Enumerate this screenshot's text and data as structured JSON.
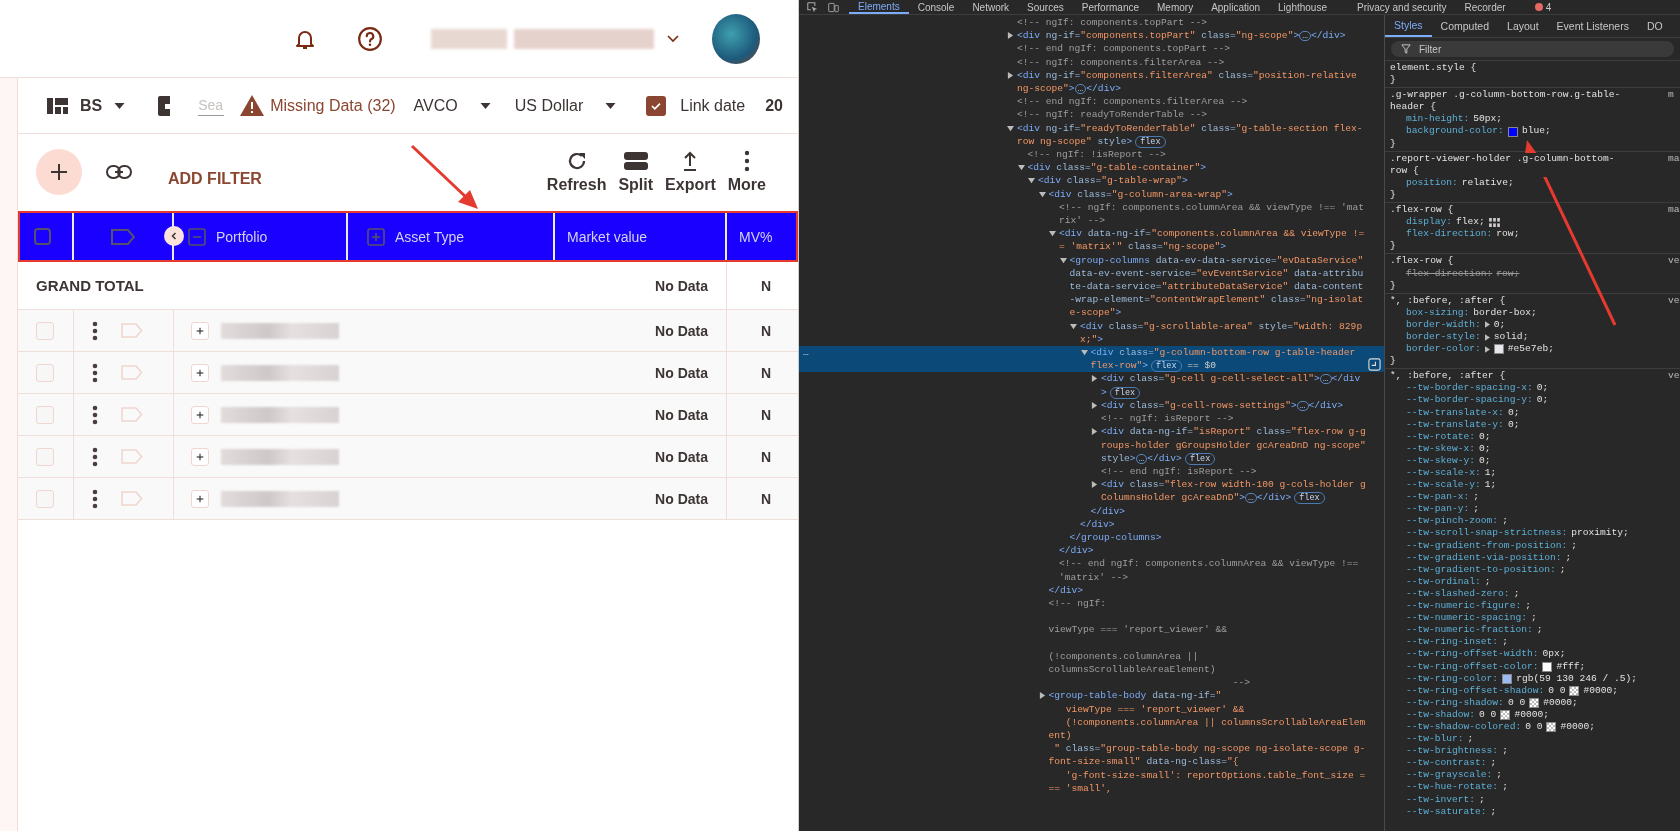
{
  "app": {
    "toolbar": {
      "layout": {
        "label": "BS"
      },
      "search": {
        "placeholder": "Sea"
      },
      "warning": {
        "label": "Missing Data (32)"
      },
      "cost_method": {
        "label": "AVCO"
      },
      "currency": {
        "label": "US Dollar"
      },
      "link_date": {
        "label": "Link date",
        "checked": true
      },
      "date": {
        "label": "20"
      }
    },
    "actions": {
      "add_filter": "ADD FILTER",
      "buttons": [
        {
          "label": "Refresh",
          "kind": "refresh"
        },
        {
          "label": "Split",
          "kind": "split"
        },
        {
          "label": "Export",
          "kind": "export"
        },
        {
          "label": "More",
          "kind": "more"
        }
      ]
    },
    "table": {
      "select_all_checked": false,
      "columns": [
        {
          "label": "Portfolio",
          "expanded": true
        },
        {
          "label": "Asset Type",
          "expanded": false
        },
        {
          "label": "Market value"
        },
        {
          "label": "MV%"
        }
      ],
      "grand_total": {
        "label": "GRAND TOTAL",
        "values": [
          "No Data",
          "N"
        ]
      },
      "rows": [
        {
          "checked": false,
          "expanded": false,
          "values": [
            "No Data",
            "N"
          ]
        },
        {
          "checked": false,
          "expanded": false,
          "values": [
            "No Data",
            "N"
          ]
        },
        {
          "checked": false,
          "expanded": false,
          "values": [
            "No Data",
            "N"
          ]
        },
        {
          "checked": false,
          "expanded": false,
          "values": [
            "No Data",
            "N"
          ]
        },
        {
          "checked": false,
          "expanded": false,
          "values": [
            "No Data",
            "N"
          ]
        }
      ]
    }
  },
  "devtools": {
    "tabs": [
      {
        "label": "Elements",
        "selected": true
      },
      {
        "label": "Console",
        "selected": false
      },
      {
        "label": "Network",
        "selected": false
      },
      {
        "label": "Sources",
        "selected": false
      },
      {
        "label": "Performance",
        "selected": false
      },
      {
        "label": "Memory",
        "selected": false
      },
      {
        "label": "Application",
        "selected": false
      },
      {
        "label": "Lighthouse",
        "selected": false
      },
      {
        "label": "Privacy and security",
        "selected": false
      },
      {
        "label": "Recorder",
        "selected": false
      }
    ],
    "error_count": "4",
    "elements": {
      "gutter_dots": "…",
      "nodes": [
        {
          "selected": false,
          "parts": [
            {
              "kind": "comment",
              "text": "<!-- ngIf: components.topPart -->"
            }
          ]
        },
        {
          "selected": false,
          "expanded": false,
          "parts": [
            {
              "kind": "tag",
              "text": "<div"
            },
            {
              "kind": "attr",
              "text": " ng-if="
            },
            {
              "kind": "value",
              "text": "\"components.topPart\""
            },
            {
              "kind": "attr",
              "text": " class="
            },
            {
              "kind": "value",
              "text": "\"ng-scope\""
            },
            {
              "kind": "tag",
              "text": ">"
            },
            {
              "kind": "ellipsis",
              "text": "…"
            },
            {
              "kind": "tag",
              "text": "</div>"
            }
          ]
        },
        {
          "selected": false,
          "parts": [
            {
              "kind": "comment",
              "text": "<!-- end ngIf: components.topPart -->"
            }
          ]
        },
        {
          "selected": false,
          "parts": [
            {
              "kind": "comment",
              "text": "<!-- ngIf: components.filterArea -->"
            }
          ]
        },
        {
          "selected": false,
          "expanded": false,
          "parts": [
            {
              "kind": "tag",
              "text": "<div"
            },
            {
              "kind": "attr",
              "text": " ng-if="
            },
            {
              "kind": "value",
              "text": "\"components.filterArea\""
            },
            {
              "kind": "attr",
              "text": " class="
            },
            {
              "kind": "value",
              "text": "\"position-relative ng-scope\""
            },
            {
              "kind": "tag",
              "text": ">"
            },
            {
              "kind": "ellipsis",
              "text": "…"
            },
            {
              "kind": "tag",
              "text": "</div>"
            }
          ]
        },
        {
          "selected": false,
          "parts": [
            {
              "kind": "comment",
              "text": "<!-- end ngIf: components.filterArea -->"
            }
          ]
        },
        {
          "selected": false,
          "parts": [
            {
              "kind": "comment",
              "text": "<!-- ngIf: readyToRenderTable -->"
            }
          ]
        },
        {
          "selected": false,
          "expanded": true,
          "parts": [
            {
              "kind": "tag",
              "text": "<div"
            },
            {
              "kind": "attr",
              "text": " ng-if="
            },
            {
              "kind": "value",
              "text": "\"readyToRenderTable\""
            },
            {
              "kind": "attr",
              "text": " class="
            },
            {
              "kind": "value",
              "text": "\"g-table-section flex-row ng-scope\""
            },
            {
              "kind": "attr",
              "text": " style"
            },
            {
              "kind": "tag",
              "text": ">"
            },
            {
              "kind": "badge",
              "text": "flex"
            }
          ],
          "children": [
            {
              "selected": false,
              "parts": [
                {
                  "kind": "comment",
                  "text": "<!-- ngIf: !isReport -->"
                }
              ]
            },
            {
              "selected": false,
              "expanded": true,
              "parts": [
                {
                  "kind": "tag",
                  "text": "<div"
                },
                {
                  "kind": "attr",
                  "text": " class="
                },
                {
                  "kind": "value",
                  "text": "\"g-table-container\""
                },
                {
                  "kind": "tag",
                  "text": ">"
                }
              ],
              "children": [
                {
                  "selected": false,
                  "expanded": true,
                  "parts": [
                    {
                      "kind": "tag",
                      "text": "<div"
                    },
                    {
                      "kind": "attr",
                      "text": " class="
                    },
                    {
                      "kind": "value",
                      "text": "\"g-table-wrap\""
                    },
                    {
                      "kind": "tag",
                      "text": ">"
                    }
                  ],
                  "children": [
                    {
                      "selected": false,
                      "expanded": true,
                      "parts": [
                        {
                          "kind": "tag",
                          "text": "<div"
                        },
                        {
                          "kind": "attr",
                          "text": " class="
                        },
                        {
                          "kind": "value",
                          "text": "\"g-column-area-wrap\""
                        },
                        {
                          "kind": "tag",
                          "text": ">"
                        }
                      ],
                      "close": [
                        {
                          "kind": "tag",
                          "text": "</div>"
                        }
                      ],
                      "children": [
                        {
                          "selected": false,
                          "parts": [
                            {
                              "kind": "comment",
                              "text": "<!-- ngIf: components.columnArea && viewType !== 'matrix' -->"
                            }
                          ]
                        },
                        {
                          "selected": false,
                          "expanded": true,
                          "parts": [
                            {
                              "kind": "tag",
                              "text": "<div"
                            },
                            {
                              "kind": "attr",
                              "text": " data-ng-if="
                            },
                            {
                              "kind": "value",
                              "text": "\"components.columnArea && viewType !== 'matrix'\""
                            },
                            {
                              "kind": "attr",
                              "text": " class="
                            },
                            {
                              "kind": "value",
                              "text": "\"ng-scope\""
                            },
                            {
                              "kind": "tag",
                              "text": ">"
                            }
                          ],
                          "close": [
                            {
                              "kind": "tag",
                              "text": "</div>"
                            }
                          ],
                          "children": [
                            {
                              "selected": false,
                              "expanded": true,
                              "parts": [
                                {
                                  "kind": "tag",
                                  "text": "<group-columns"
                                },
                                {
                                  "kind": "attr",
                                  "text": " data-ev-data-service="
                                },
                                {
                                  "kind": "value",
                                  "text": "\"evDataService\""
                                },
                                {
                                  "kind": "attr",
                                  "text": " data-ev-event-service="
                                },
                                {
                                  "kind": "value",
                                  "text": "\"evEventService\""
                                },
                                {
                                  "kind": "attr",
                                  "text": " data-attribute-data-service="
                                },
                                {
                                  "kind": "value",
                                  "text": "\"attributeDataService\""
                                },
                                {
                                  "kind": "attr",
                                  "text": " data-content-wrap-element="
                                },
                                {
                                  "kind": "value",
                                  "text": "\"contentWrapElement\""
                                },
                                {
                                  "kind": "attr",
                                  "text": " class="
                                },
                                {
                                  "kind": "value",
                                  "text": "\"ng-isolate-scope\""
                                },
                                {
                                  "kind": "tag",
                                  "text": ">"
                                }
                              ],
                              "close": [
                                {
                                  "kind": "tag",
                                  "text": "</group-columns>"
                                }
                              ],
                              "children": [
                                {
                                  "selected": false,
                                  "expanded": true,
                                  "parts": [
                                    {
                                      "kind": "tag",
                                      "text": "<div"
                                    },
                                    {
                                      "kind": "attr",
                                      "text": " class="
                                    },
                                    {
                                      "kind": "value",
                                      "text": "\"g-scrollable-area\""
                                    },
                                    {
                                      "kind": "attr",
                                      "text": " style="
                                    },
                                    {
                                      "kind": "value",
                                      "text": "\"width: 829px;\""
                                    },
                                    {
                                      "kind": "tag",
                                      "text": ">"
                                    }
                                  ],
                                  "close": [
                                    {
                                      "kind": "tag",
                                      "text": "</div>"
                                    }
                                  ],
                                  "children": [
                                    {
                                      "selected": true,
                                      "expanded": true,
                                      "parts": [
                                        {
                                          "kind": "tag",
                                          "text": "<div"
                                        },
                                        {
                                          "kind": "attr",
                                          "text": " class="
                                        },
                                        {
                                          "kind": "value",
                                          "text": "\"g-column-bottom-row g-table-header flex-row\""
                                        },
                                        {
                                          "kind": "tag",
                                          "text": ">"
                                        },
                                        {
                                          "kind": "badge",
                                          "text": "flex"
                                        },
                                        {
                                          "kind": "ref",
                                          "text": " == $0"
                                        }
                                      ],
                                      "close": [
                                        {
                                          "kind": "tag",
                                          "text": "</div>"
                                        }
                                      ],
                                      "children": [
                                        {
                                          "selected": false,
                                          "expanded": false,
                                          "parts": [
                                            {
                                              "kind": "tag",
                                              "text": "<div"
                                            },
                                            {
                                              "kind": "attr",
                                              "text": " class="
                                            },
                                            {
                                              "kind": "value",
                                              "text": "\"g-cell g-cell-select-all\""
                                            },
                                            {
                                              "kind": "tag",
                                              "text": ">"
                                            },
                                            {
                                              "kind": "ellipsis",
                                              "text": "…"
                                            },
                                            {
                                              "kind": "tag",
                                              "text": "</div>"
                                            },
                                            {
                                              "kind": "badge",
                                              "text": "flex"
                                            }
                                          ]
                                        },
                                        {
                                          "selected": false,
                                          "expanded": false,
                                          "parts": [
                                            {
                                              "kind": "tag",
                                              "text": "<div"
                                            },
                                            {
                                              "kind": "attr",
                                              "text": " class="
                                            },
                                            {
                                              "kind": "value",
                                              "text": "\"g-cell-rows-settings\""
                                            },
                                            {
                                              "kind": "tag",
                                              "text": ">"
                                            },
                                            {
                                              "kind": "ellipsis",
                                              "text": "…"
                                            },
                                            {
                                              "kind": "tag",
                                              "text": "</div>"
                                            }
                                          ]
                                        },
                                        {
                                          "selected": false,
                                          "parts": [
                                            {
                                              "kind": "comment",
                                              "text": "<!-- ngIf: isReport -->"
                                            }
                                          ]
                                        },
                                        {
                                          "selected": false,
                                          "expanded": false,
                                          "parts": [
                                            {
                                              "kind": "tag",
                                              "text": "<div"
                                            },
                                            {
                                              "kind": "attr",
                                              "text": " data-ng-if="
                                            },
                                            {
                                              "kind": "value",
                                              "text": "\"isReport\""
                                            },
                                            {
                                              "kind": "attr",
                                              "text": " class="
                                            },
                                            {
                                              "kind": "value",
                                              "text": "\"flex-row g-groups-holder gGroupsHolder gcAreaDnD ng-scope\""
                                            },
                                            {
                                              "kind": "attr",
                                              "text": " style"
                                            },
                                            {
                                              "kind": "tag",
                                              "text": ">"
                                            },
                                            {
                                              "kind": "ellipsis",
                                              "text": "…"
                                            },
                                            {
                                              "kind": "tag",
                                              "text": "</div>"
                                            },
                                            {
                                              "kind": "badge",
                                              "text": "flex"
                                            }
                                          ]
                                        },
                                        {
                                          "selected": false,
                                          "parts": [
                                            {
                                              "kind": "comment",
                                              "text": "<!-- end ngIf: isReport -->"
                                            }
                                          ]
                                        },
                                        {
                                          "selected": false,
                                          "expanded": false,
                                          "parts": [
                                            {
                                              "kind": "tag",
                                              "text": "<div"
                                            },
                                            {
                                              "kind": "attr",
                                              "text": " class="
                                            },
                                            {
                                              "kind": "value",
                                              "text": "\"flex-row width-100 g-cols-holder gColumnsHolder gcAreaDnD\""
                                            },
                                            {
                                              "kind": "tag",
                                              "text": ">"
                                            },
                                            {
                                              "kind": "ellipsis",
                                              "text": "…"
                                            },
                                            {
                                              "kind": "tag",
                                              "text": "</div>"
                                            },
                                            {
                                              "kind": "badge",
                                              "text": "flex"
                                            }
                                          ]
                                        }
                                      ]
                                    }
                                  ]
                                }
                              ]
                            }
                          ]
                        },
                        {
                          "selected": false,
                          "parts": [
                            {
                              "kind": "comment",
                              "text": "<!-- end ngIf: components.columnArea && viewType !== 'matrix' -->"
                            }
                          ]
                        }
                      ]
                    },
                    {
                      "selected": false,
                      "parts": [
                        {
                          "kind": "comment",
                          "text": "<!-- ngIf:\n\nviewType === 'report_viewer' &&\n\n(!components.columnArea ||\ncolumnsScrollableAreaElement)\n                                -->"
                        }
                      ]
                    },
                    {
                      "selected": false,
                      "expanded": false,
                      "parts": [
                        {
                          "kind": "tag",
                          "text": "<group-table-body"
                        },
                        {
                          "kind": "attr",
                          "text": " data-ng-if="
                        },
                        {
                          "kind": "value",
                          "text": "\"\n   viewType === 'report_viewer' &&\n   (!components.columnArea || columnsScrollableAreaElement)\n \""
                        },
                        {
                          "kind": "attr",
                          "text": " class="
                        },
                        {
                          "kind": "value",
                          "text": "\"group-table-body ng-scope ng-isolate-scope g-font-size-small\""
                        },
                        {
                          "kind": "attr",
                          "text": " data-ng-class="
                        },
                        {
                          "kind": "value",
                          "text": "\"{\n   'g-font-size-small': reportOptions.table_font_size === 'small',"
                        }
                      ]
                    }
                  ]
                }
              ]
            }
          ]
        }
      ]
    },
    "styles": {
      "tabs": [
        {
          "label": "Styles",
          "selected": true
        },
        {
          "label": "Computed",
          "selected": false
        },
        {
          "label": "Layout",
          "selected": false
        },
        {
          "label": "Event Listeners",
          "selected": false
        },
        {
          "label": "DO",
          "selected": false
        }
      ],
      "filter_placeholder": "Filter",
      "rules": [
        {
          "selector": "element.style {",
          "close": "}"
        },
        {
          "selector": ".g-wrapper .g-column-bottom-row.g-table-header {",
          "source": "m",
          "close": "}",
          "decls": [
            {
              "name": "min-height:",
              "value": "50px;",
              "overridden": false
            },
            {
              "name": "background-color:",
              "swatch": {
                "kind": "solid",
                "color": "#0000ff"
              },
              "value": "blue;",
              "overridden": false
            }
          ]
        },
        {
          "selector": ".report-viewer-holder .g-column-bottom-row {",
          "source": "ma",
          "close": "}",
          "decls": [
            {
              "name": "position:",
              "value": "relative;",
              "overridden": false
            }
          ]
        },
        {
          "selector": ".flex-row {",
          "source": "ma",
          "close": "}",
          "decls": [
            {
              "name": "display:",
              "value": "flex;",
              "flex_editor": true,
              "overridden": false
            },
            {
              "name": "flex-direction:",
              "value": "row;",
              "overridden": false
            }
          ]
        },
        {
          "selector": ".flex-row {",
          "source": "ve",
          "close": "}",
          "decls": [
            {
              "name": "flex-direction:",
              "value": "row;",
              "overridden": true
            }
          ]
        },
        {
          "selector": "*, :before, :after {",
          "source": "ve",
          "close": "}",
          "decls": [
            {
              "name": "box-sizing:",
              "value": "border-box;",
              "overridden": false
            },
            {
              "name": "border-width:",
              "expandable": true,
              "value": "0;",
              "overridden": false
            },
            {
              "name": "border-style:",
              "expandable": true,
              "value": "solid;",
              "overridden": false
            },
            {
              "name": "border-color:",
              "expandable": true,
              "swatch": {
                "kind": "solid",
                "color": "#e5e7eb"
              },
              "value": "#e5e7eb;",
              "overridden": false
            }
          ]
        },
        {
          "selector": "*, :before, :after {",
          "source": "ve",
          "decls": [
            {
              "name": "--tw-border-spacing-x:",
              "value": "0;",
              "overridden": false
            },
            {
              "name": "--tw-border-spacing-y:",
              "value": "0;",
              "overridden": false
            },
            {
              "name": "--tw-translate-x:",
              "value": "0;",
              "overridden": false
            },
            {
              "name": "--tw-translate-y:",
              "value": "0;",
              "overridden": false
            },
            {
              "name": "--tw-rotate:",
              "value": "0;",
              "overridden": false
            },
            {
              "name": "--tw-skew-x:",
              "value": "0;",
              "overridden": false
            },
            {
              "name": "--tw-skew-y:",
              "value": "0;",
              "overridden": false
            },
            {
              "name": "--tw-scale-x:",
              "value": "1;",
              "overridden": false
            },
            {
              "name": "--tw-scale-y:",
              "value": "1;",
              "overridden": false
            },
            {
              "name": "--tw-pan-x:",
              "value": ";",
              "overridden": false
            },
            {
              "name": "--tw-pan-y:",
              "value": ";",
              "overridden": false
            },
            {
              "name": "--tw-pinch-zoom:",
              "value": ";",
              "overridden": false
            },
            {
              "name": "--tw-scroll-snap-strictness:",
              "value": "proximity;",
              "overridden": false
            },
            {
              "name": "--tw-gradient-from-position:",
              "value": ";",
              "overridden": false
            },
            {
              "name": "--tw-gradient-via-position:",
              "value": ";",
              "overridden": false
            },
            {
              "name": "--tw-gradient-to-position:",
              "value": ";",
              "overridden": false
            },
            {
              "name": "--tw-ordinal:",
              "value": ";",
              "overridden": false
            },
            {
              "name": "--tw-slashed-zero:",
              "value": ";",
              "overridden": false
            },
            {
              "name": "--tw-numeric-figure:",
              "value": ";",
              "overridden": false
            },
            {
              "name": "--tw-numeric-spacing:",
              "value": ";",
              "overridden": false
            },
            {
              "name": "--tw-numeric-fraction:",
              "value": ";",
              "overridden": false
            },
            {
              "name": "--tw-ring-inset:",
              "value": ";",
              "overridden": false
            },
            {
              "name": "--tw-ring-offset-width:",
              "value": "0px;",
              "overridden": false
            },
            {
              "name": "--tw-ring-offset-color:",
              "swatch": {
                "kind": "solid",
                "color": "#ffffff"
              },
              "value": "#fff;",
              "overridden": false
            },
            {
              "name": "--tw-ring-color:",
              "swatch": {
                "kind": "solid",
                "color": "#9dbbf3"
              },
              "value": "rgb(59 130 246 / .5);",
              "overridden": false
            },
            {
              "name": "--tw-ring-offset-shadow:",
              "value_prefix": "0 0",
              "swatch": {
                "kind": "checker"
              },
              "value": "#0000;",
              "overridden": false
            },
            {
              "name": "--tw-ring-shadow:",
              "value_prefix": "0 0",
              "swatch": {
                "kind": "checker"
              },
              "value": "#0000;",
              "overridden": false
            },
            {
              "name": "--tw-shadow:",
              "value_prefix": "0 0",
              "swatch": {
                "kind": "checker"
              },
              "value": "#0000;",
              "overridden": false
            },
            {
              "name": "--tw-shadow-colored:",
              "value_prefix": "0 0",
              "swatch": {
                "kind": "checker"
              },
              "value": "#0000;",
              "overridden": false
            },
            {
              "name": "--tw-blur:",
              "value": ";",
              "overridden": false
            },
            {
              "name": "--tw-brightness:",
              "value": ";",
              "overridden": false
            },
            {
              "name": "--tw-contrast:",
              "value": ";",
              "overridden": false
            },
            {
              "name": "--tw-grayscale:",
              "value": ";",
              "overridden": false
            },
            {
              "name": "--tw-hue-rotate:",
              "value": ";",
              "overridden": false
            },
            {
              "name": "--tw-invert:",
              "value": ";",
              "overridden": false
            },
            {
              "name": "--tw-saturate:",
              "value": ";",
              "overridden": false
            }
          ]
        }
      ]
    }
  }
}
